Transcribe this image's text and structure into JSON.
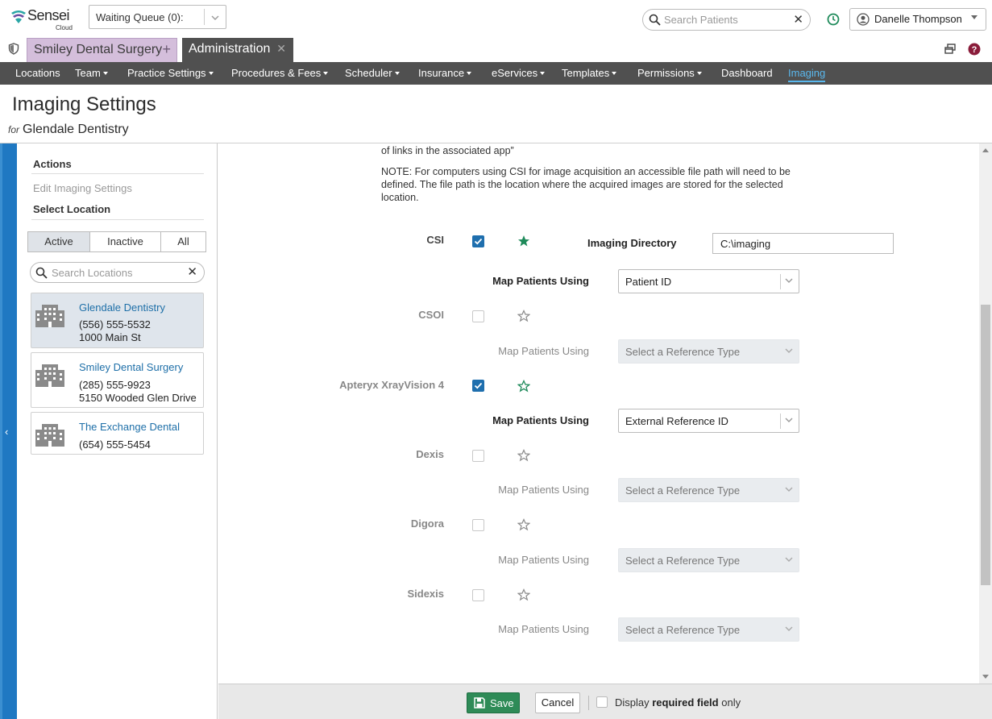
{
  "app": {
    "logo_text": "Sensei",
    "logo_sub": "Cloud",
    "waiting_queue": "Waiting Queue (0):",
    "search_placeholder": "Search Patients",
    "user_name": "Danelle Thompson"
  },
  "tabs": {
    "practice": "Smiley Dental Surgery",
    "admin": "Administration"
  },
  "nav": [
    {
      "label": "Locations",
      "dropdown": false
    },
    {
      "label": "Team",
      "dropdown": true
    },
    {
      "label": "Practice Settings",
      "dropdown": true
    },
    {
      "label": "Procedures & Fees",
      "dropdown": true
    },
    {
      "label": "Scheduler",
      "dropdown": true
    },
    {
      "label": "Insurance",
      "dropdown": true
    },
    {
      "label": "eServices",
      "dropdown": true
    },
    {
      "label": "Templates",
      "dropdown": true
    },
    {
      "label": "Permissions",
      "dropdown": true
    },
    {
      "label": "Dashboard",
      "dropdown": false
    },
    {
      "label": "Imaging",
      "dropdown": false,
      "active": true
    }
  ],
  "page": {
    "title": "Imaging Settings",
    "for_label": "for",
    "subtitle": "Glendale Dentistry"
  },
  "sidebar": {
    "actions_heading": "Actions",
    "edit_link": "Edit Imaging Settings",
    "select_heading": "Select Location",
    "filters": [
      "Active",
      "Inactive",
      "All"
    ],
    "active_filter": "Active",
    "search_placeholder": "Search Locations",
    "locations": [
      {
        "name": "Glendale Dentistry",
        "phone": "(556) 555-5532",
        "address": "1000 Main St",
        "selected": true
      },
      {
        "name": "Smiley Dental Surgery",
        "phone": "(285) 555-9923",
        "address": "5150 Wooded Glen Drive",
        "selected": false
      },
      {
        "name": "The Exchange Dental",
        "phone": "(654) 555-5454",
        "address": "",
        "selected": false
      }
    ]
  },
  "main": {
    "intro_tail": "of links in the associated app”",
    "note": "NOTE: For computers using CSI for image acquisition an accessible file path will need to be defined. The file path is the location where the acquired images are stored for the selected location.",
    "imaging_directory_label": "Imaging Directory",
    "imaging_directory_value": "C:\\imaging",
    "map_label": "Map Patients Using",
    "select_placeholder": "Select a Reference Type",
    "integrations": [
      {
        "name": "CSI",
        "checked": true,
        "default": true,
        "map_value": "Patient ID"
      },
      {
        "name": "CSOI",
        "checked": false,
        "default": false,
        "map_value": ""
      },
      {
        "name": "Apteryx XrayVision 4",
        "checked": true,
        "default": false,
        "map_value": "External Reference ID"
      },
      {
        "name": "Dexis",
        "checked": false,
        "default": false,
        "map_value": ""
      },
      {
        "name": "Digora",
        "checked": false,
        "default": false,
        "map_value": ""
      },
      {
        "name": "Sidexis",
        "checked": false,
        "default": false,
        "map_value": ""
      }
    ]
  },
  "footer": {
    "save": "Save",
    "cancel": "Cancel",
    "display_prefix": "Display",
    "display_bold": "required field",
    "display_suffix": "only"
  },
  "colors": {
    "nav_bg": "#505050",
    "accent_blue": "#1f78c2",
    "active_nav": "#5ab8ee",
    "save_green": "#2e8b57",
    "practice_tab": "#d4bedb",
    "star_green": "#1e8a5a"
  }
}
